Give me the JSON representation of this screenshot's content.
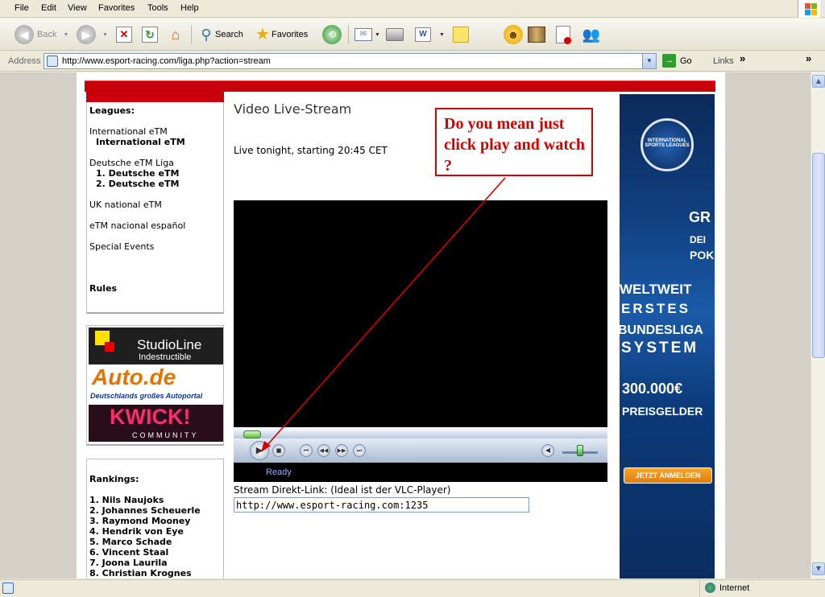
{
  "menu": [
    "File",
    "Edit",
    "View",
    "Favorites",
    "Tools",
    "Help"
  ],
  "toolbar": {
    "back": "Back",
    "search": "Search",
    "favorites": "Favorites"
  },
  "address": {
    "label": "Address",
    "url": "http://www.esport-racing.com/liga.php?action=stream",
    "go": "Go",
    "links": "Links",
    "chevron": "»"
  },
  "sidebar": {
    "leagues_title": "Leagues:",
    "items": [
      {
        "label": "International eTM",
        "bold": false
      },
      {
        "label": "International eTM",
        "bold": true
      },
      {
        "label": "Deutsche eTM Liga",
        "bold": false
      },
      {
        "label": "1. Deutsche eTM",
        "bold": true
      },
      {
        "label": "2. Deutsche eTM",
        "bold": true
      },
      {
        "label": "UK national eTM",
        "bold": false
      },
      {
        "label": "eTM nacional español",
        "bold": false
      },
      {
        "label": "Special Events",
        "bold": false
      },
      {
        "label": "Rules",
        "bold": true
      }
    ],
    "sponsors": [
      "StudioLine",
      "Indestructible",
      "Auto.de",
      "Deutschlands großes Autoportal",
      "KWICK!",
      "COMMUNITY"
    ],
    "rankings_title": "Rankings:",
    "rankings": [
      "1. Nils Naujoks",
      "2. Johannes Scheuerle",
      "3. Raymond Mooney",
      "4. Hendrik von Eye",
      "5. Marco Schade",
      "6. Vincent Staal",
      "7. Joona Laurila",
      "8. Christian Krognes"
    ]
  },
  "main": {
    "title": "Video Live-Stream",
    "live": "Live tonight, starting 20:45 CET",
    "player_status": "Ready",
    "direkt_label": "Stream Direkt-Link: (Ideal ist der VLC-Player)",
    "direkt_value": "http://www.esport-racing.com:1235"
  },
  "ad": {
    "logo": "INTERNATIONAL SPORTS LEAGUES",
    "lines": [
      "GR",
      "DEI",
      "POK",
      "WELTWEIT",
      "ERSTES",
      "BUNDESLIGA",
      "SYSTEM",
      "300.000€",
      "PREISGELDER"
    ],
    "button": "JETZT ANMELDEN"
  },
  "annotation": {
    "text": "Do you mean just click play and watch ?",
    "color": "#d40000"
  },
  "statusbar": {
    "zone": "Internet"
  }
}
